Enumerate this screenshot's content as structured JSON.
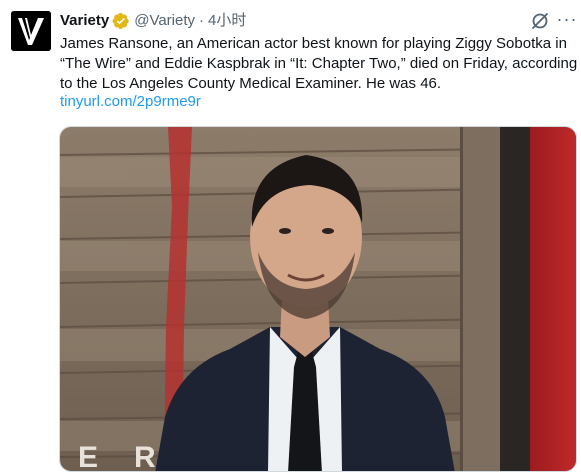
{
  "tweet": {
    "display_name": "Variety",
    "handle": "@Variety",
    "separator": "·",
    "time": "4小时",
    "text": "James Ransone, an American actor best known for playing Ziggy Sobotka in “The Wire” and Eddie Kaspbrak in “It: Chapter Two,” died on Friday, according to the Los Angeles County Medical Examiner. He was 46.",
    "link": "tinyurl.com/2p9rme9r",
    "more_label": "···",
    "avatar_logo_letter": "V",
    "backdrop_letters": [
      "E",
      "R"
    ]
  },
  "colors": {
    "link": "#1d9bf0",
    "verified_badge": "#e2b719",
    "secondary_text": "#536471"
  },
  "icons": {
    "verified": "verified-badge-icon",
    "grok": "grok-icon",
    "more": "more-icon"
  }
}
